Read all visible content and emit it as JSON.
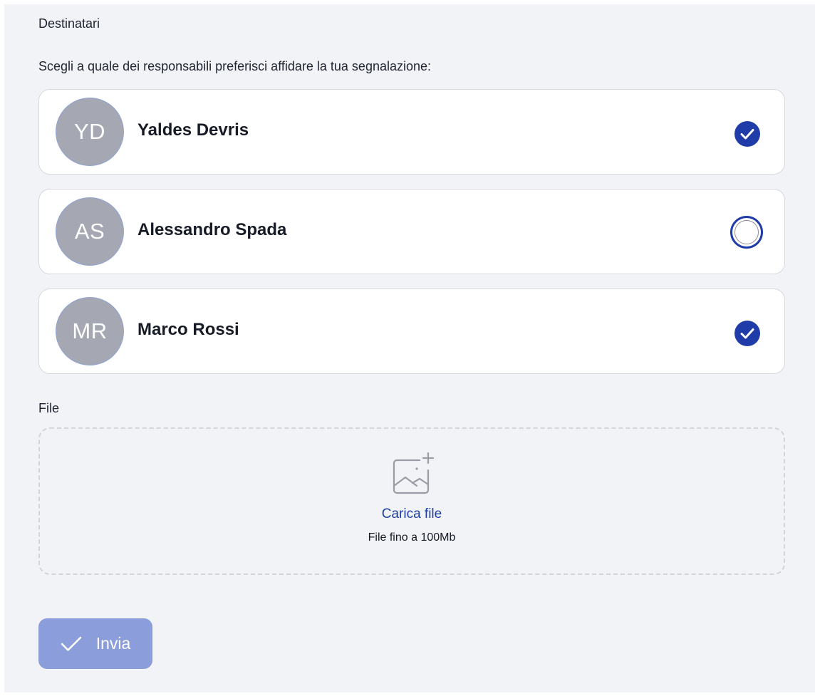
{
  "form": {
    "recipients_label": "Destinatari",
    "recipients_instruction": "Scegli a quale dei responsabili preferisci affidare la tua segnalazione:",
    "file_label": "File"
  },
  "recipients": [
    {
      "initials": "YD",
      "name": "Yaldes Devris",
      "selected": true
    },
    {
      "initials": "AS",
      "name": "Alessandro Spada",
      "selected": false
    },
    {
      "initials": "MR",
      "name": "Marco Rossi",
      "selected": true
    }
  ],
  "upload": {
    "icon": "image-add-icon",
    "link_label": "Carica file",
    "hint": "File fino a 100Mb"
  },
  "submit": {
    "icon": "check-icon",
    "label": "Invia"
  },
  "colors": {
    "accent": "#1f3ca8",
    "submit_disabled": "#8c9ddb",
    "avatar_bg": "#a5a8b2",
    "panel_bg": "#f2f3f6"
  }
}
